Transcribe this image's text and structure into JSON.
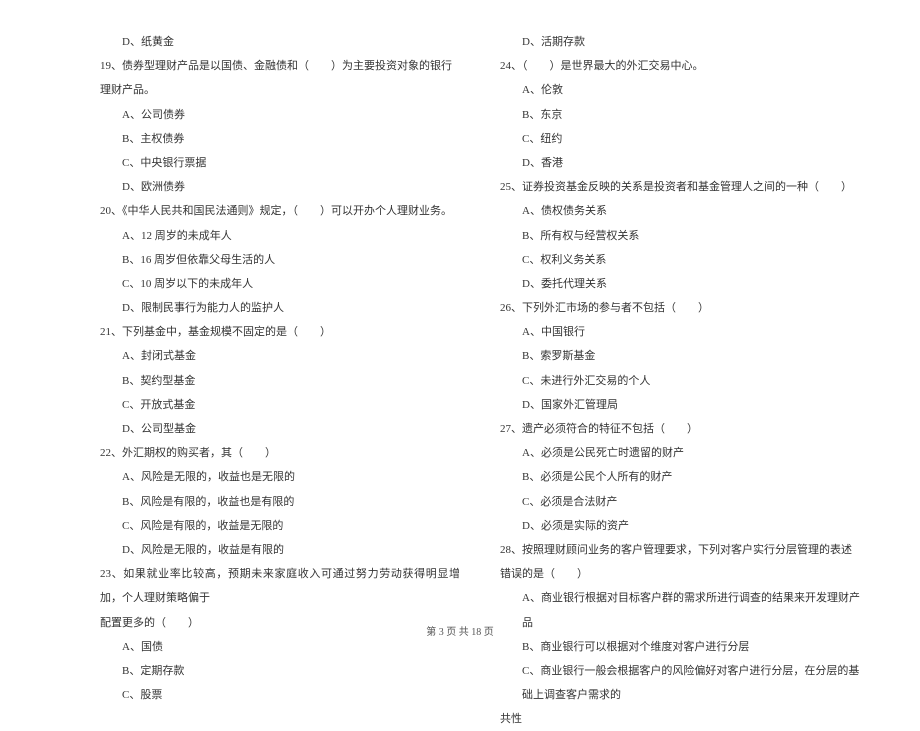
{
  "left": {
    "opt_18d": "D、纸黄金",
    "q19": "19、债券型理财产品是以国债、金融债和（　　）为主要投资对象的银行理财产品。",
    "q19a": "A、公司债券",
    "q19b": "B、主权债券",
    "q19c": "C、中央银行票据",
    "q19d": "D、欧洲债券",
    "q20": "20、《中华人民共和国民法通则》规定，（　　）可以开办个人理财业务。",
    "q20a": "A、12 周岁的未成年人",
    "q20b": "B、16 周岁但依靠父母生活的人",
    "q20c": "C、10 周岁以下的未成年人",
    "q20d": "D、限制民事行为能力人的监护人",
    "q21": "21、下列基金中，基金规模不固定的是（　　）",
    "q21a": "A、封闭式基金",
    "q21b": "B、契约型基金",
    "q21c": "C、开放式基金",
    "q21d": "D、公司型基金",
    "q22": "22、外汇期权的购买者，其（　　）",
    "q22a": "A、风险是无限的，收益也是无限的",
    "q22b": "B、风险是有限的，收益也是有限的",
    "q22c": "C、风险是有限的，收益是无限的",
    "q22d": "D、风险是无限的，收益是有限的",
    "q23": "23、如果就业率比较高，预期未来家庭收入可通过努力劳动获得明显增加，个人理财策略偏于",
    "q23_cont": "配置更多的（　　）",
    "q23a": "A、国债",
    "q23b": "B、定期存款",
    "q23c": "C、股票"
  },
  "right": {
    "opt_23d": "D、活期存款",
    "q24": "24、（　　）是世界最大的外汇交易中心。",
    "q24a": "A、伦敦",
    "q24b": "B、东京",
    "q24c": "C、纽约",
    "q24d": "D、香港",
    "q25": "25、证券投资基金反映的关系是投资者和基金管理人之间的一种（　　）",
    "q25a": "A、债权债务关系",
    "q25b": "B、所有权与经营权关系",
    "q25c": "C、权利义务关系",
    "q25d": "D、委托代理关系",
    "q26": "26、下列外汇市场的参与者不包括（　　）",
    "q26a": "A、中国银行",
    "q26b": "B、索罗斯基金",
    "q26c": "C、未进行外汇交易的个人",
    "q26d": "D、国家外汇管理局",
    "q27": "27、遗产必须符合的特征不包括（　　）",
    "q27a": "A、必须是公民死亡时遗留的财产",
    "q27b": "B、必须是公民个人所有的财产",
    "q27c": "C、必须是合法财产",
    "q27d": "D、必须是实际的资产",
    "q28": "28、按照理财顾问业务的客户管理要求，下列对客户实行分层管理的表述错误的是（　　）",
    "q28a": "A、商业银行根据对目标客户群的需求所进行调查的结果来开发理财产品",
    "q28b": "B、商业银行可以根据对个维度对客户进行分层",
    "q28c": "C、商业银行一般会根据客户的风险偏好对客户进行分层，在分层的基础上调查客户需求的",
    "q28c_cont": "共性"
  },
  "footer": "第 3 页 共 18 页"
}
